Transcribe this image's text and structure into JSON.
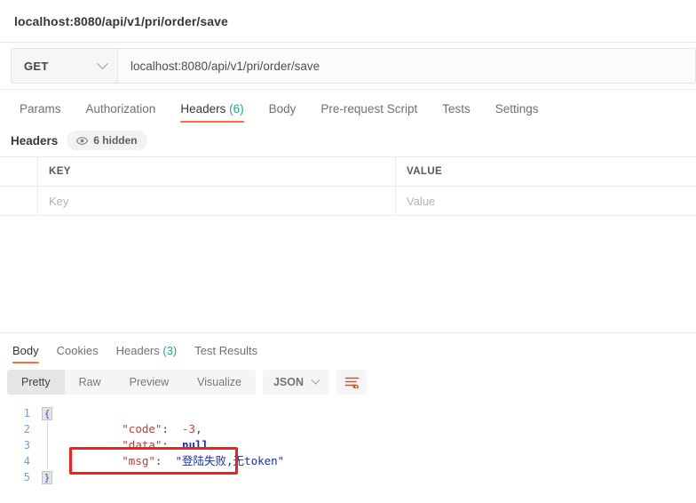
{
  "titlebar": {
    "title": "localhost:8080/api/v1/pri/order/save"
  },
  "request": {
    "method": "GET",
    "method_icon": "chevron-down-icon",
    "url": "localhost:8080/api/v1/pri/order/save",
    "tabs": [
      {
        "label": "Params",
        "active": false,
        "count": ""
      },
      {
        "label": "Authorization",
        "active": false,
        "count": ""
      },
      {
        "label": "Headers",
        "active": true,
        "count": "(6)"
      },
      {
        "label": "Body",
        "active": false,
        "count": ""
      },
      {
        "label": "Pre-request Script",
        "active": false,
        "count": ""
      },
      {
        "label": "Tests",
        "active": false,
        "count": ""
      },
      {
        "label": "Settings",
        "active": false,
        "count": ""
      }
    ]
  },
  "headers_panel": {
    "title": "Headers",
    "hidden_pill": "6 hidden",
    "eye_icon": "eye-icon",
    "columns": {
      "key": "KEY",
      "value": "VALUE"
    },
    "rows": [
      {
        "key_placeholder": "Key",
        "value_placeholder": "Value"
      }
    ]
  },
  "response": {
    "tabs": [
      {
        "label": "Body",
        "active": true,
        "count": ""
      },
      {
        "label": "Cookies",
        "active": false,
        "count": ""
      },
      {
        "label": "Headers",
        "active": false,
        "count": "(3)"
      },
      {
        "label": "Test Results",
        "active": false,
        "count": ""
      }
    ],
    "formats": [
      {
        "label": "Pretty",
        "active": true
      },
      {
        "label": "Raw",
        "active": false
      },
      {
        "label": "Preview",
        "active": false
      },
      {
        "label": "Visualize",
        "active": false
      }
    ],
    "language": "JSON",
    "language_icon": "chevron-down-icon",
    "wrap_icon": "wrap-text-icon",
    "code": {
      "lines": [
        {
          "n": "1",
          "open_brace": "{"
        },
        {
          "n": "2",
          "key": "\"code\"",
          "colon": ": ",
          "value": "-3",
          "comma": ",",
          "type": "num"
        },
        {
          "n": "3",
          "key": "\"data\"",
          "colon": ": ",
          "value": "null",
          "comma": ",",
          "type": "null"
        },
        {
          "n": "4",
          "key": "\"msg\"",
          "colon": ": ",
          "value": "\"登陆失败,无token\"",
          "comma": "",
          "type": "str"
        },
        {
          "n": "5",
          "close_brace": "}"
        }
      ]
    }
  },
  "annotation": {
    "name": "red-highlight-box",
    "color": "#f41f1f"
  },
  "colors": {
    "accent": "#ff6c37",
    "count_green": "#1cab7f",
    "annotation_red": "#f41f1f"
  }
}
